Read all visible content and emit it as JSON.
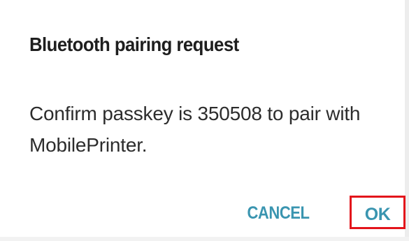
{
  "dialog": {
    "title": "Bluetooth pairing request",
    "message": "Confirm passkey is 350508 to pair with MobilePrinter.",
    "buttons": {
      "cancel_label": "CANCEL",
      "ok_label": "OK"
    },
    "colors": {
      "accent": "#3a95b0",
      "highlight_border": "#e3141b",
      "title_text": "#1e1e1e",
      "body_text": "#2c2c2c"
    }
  }
}
